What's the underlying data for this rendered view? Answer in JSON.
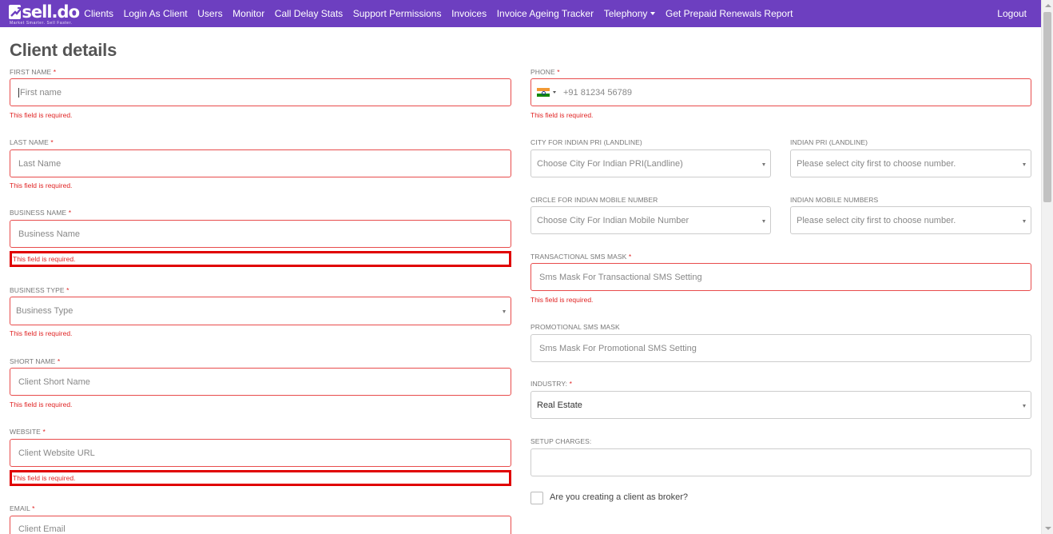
{
  "navbar": {
    "logo_text": "sell.do",
    "logo_tagline": "Market Smarter. Sell Faster.",
    "items": [
      "Clients",
      "Login As Client",
      "Users",
      "Monitor",
      "Call Delay Stats",
      "Support Permissions",
      "Invoices",
      "Invoice Ageing Tracker",
      "Telephony",
      "Get Prepaid Renewals Report"
    ],
    "logout": "Logout",
    "bg_color": "#6d3fc0"
  },
  "page": {
    "title": "Client details"
  },
  "required_marker": "*",
  "left": {
    "first_name": {
      "label": "First name",
      "placeholder": "First name",
      "error": "This field is required."
    },
    "last_name": {
      "label": "Last name",
      "placeholder": "Last Name",
      "error": "This field is required."
    },
    "business_name": {
      "label": "Business name",
      "placeholder": "Business Name",
      "error": "This field is required."
    },
    "business_type": {
      "label": "Business type",
      "value": "Business Type",
      "error": "This field is required."
    },
    "short_name": {
      "label": "Short name",
      "placeholder": "Client Short Name",
      "error": "This field is required."
    },
    "website": {
      "label": "Website",
      "placeholder": "Client Website URL",
      "error": "This field is required."
    },
    "email": {
      "label": "Email",
      "placeholder": "Client Email"
    }
  },
  "right": {
    "phone": {
      "label": "Phone",
      "placeholder": "+91 81234 56789",
      "flag": "india-flag-icon",
      "error": "This field is required."
    },
    "city_pri": {
      "label": "City for Indian PRI (landline)",
      "value": "Choose City For Indian PRI(Landline)"
    },
    "indian_pri": {
      "label": "Indian PRI (landline)",
      "value": "Please select city first to choose number."
    },
    "circle_mobile": {
      "label": "Circle for Indian mobile number",
      "value": "Choose City For Indian Mobile Number"
    },
    "mobile_numbers": {
      "label": "Indian mobile numbers",
      "value": "Please select city first to choose number."
    },
    "transactional_sms": {
      "label": "Transactional SMS mask",
      "placeholder": "Sms Mask For Transactional SMS Setting",
      "error": "This field is required."
    },
    "promotional_sms": {
      "label": "Promotional SMS mask",
      "placeholder": "Sms Mask For Promotional SMS Setting"
    },
    "industry": {
      "label": "Industry:",
      "value": "Real Estate"
    },
    "setup_charges": {
      "label": "Setup charges:",
      "value": ""
    },
    "broker_checkbox": {
      "label": "Are you creating a client as broker?",
      "checked": false
    }
  },
  "colors": {
    "error": "#e02424",
    "highlight": "#e00000"
  }
}
